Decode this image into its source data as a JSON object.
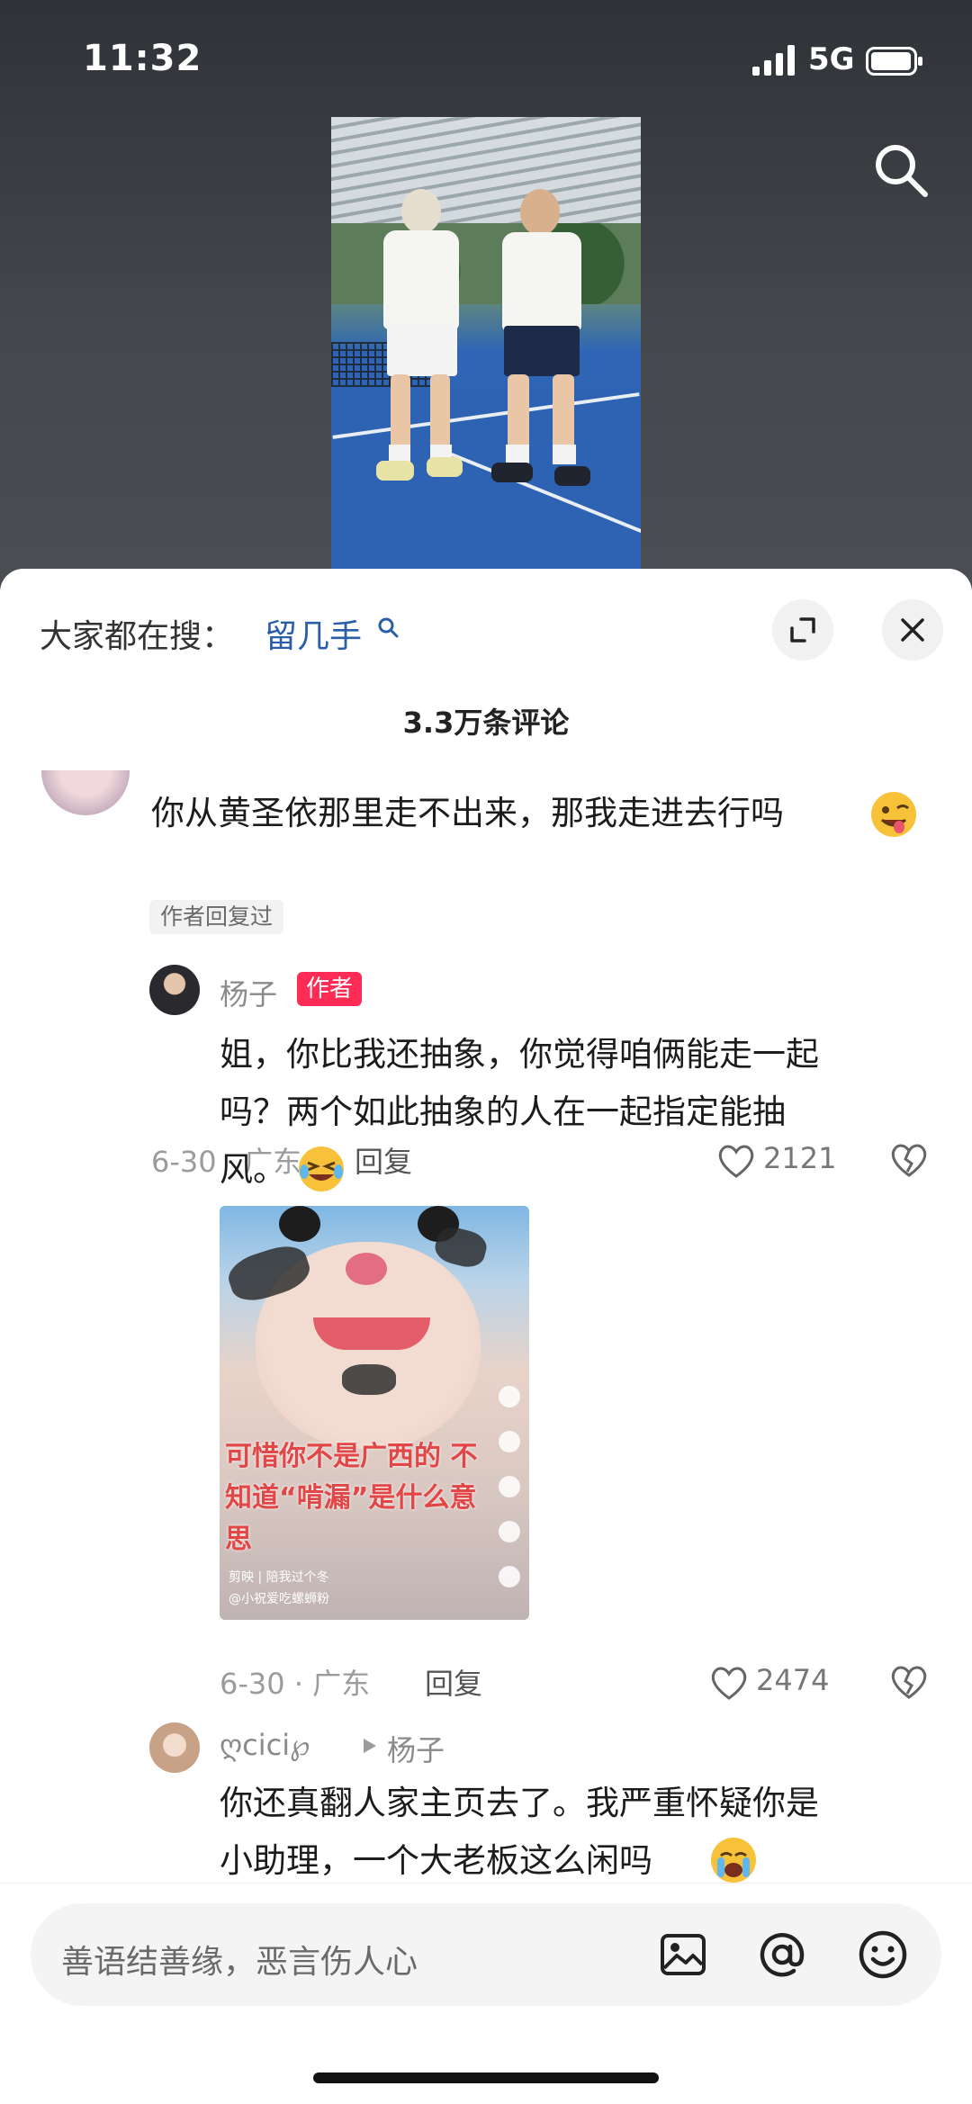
{
  "status": {
    "time": "11:32",
    "network": "5G"
  },
  "icons": {
    "search": "search-icon",
    "expand": "expand-icon",
    "close": "close-icon",
    "like": "heart-icon",
    "dislike": "broken-heart-icon",
    "image": "image-icon",
    "mention": "at-icon",
    "emoji": "smiley-icon"
  },
  "hot_search": {
    "label": "大家都在搜：",
    "term": "留几手"
  },
  "comments_header": {
    "count_text": "3.3万条评论"
  },
  "comments": [
    {
      "text_line1": "你从黄圣依那里走不出来，那我走进去行吗",
      "meta": "6-30 · 广东",
      "reply_label": "回复",
      "likes": "2121",
      "author_replied": "作者回复过"
    }
  ],
  "replies": [
    {
      "username": "杨子",
      "badge": "作者",
      "text_line1": "姐，你比我还抽象，你觉得咱俩能走一起",
      "text_line2": "吗？两个如此抽象的人在一起指定能抽",
      "text_line3": "风。",
      "image_caption": "可惜你不是广西的 不知道“啃漏”是什么意思",
      "image_footer1": "剪映 | 陪我过个冬",
      "image_footer2": "@小祝爱吃螺蛳粉",
      "meta": "6-30 · 广东",
      "reply_label": "回复",
      "likes": "2474"
    },
    {
      "username": "ღcici℘",
      "reply_to": "杨子",
      "text_line1": "你还真翻人家主页去了。我严重怀疑你是",
      "text_line2": "小助理，一个大老板这么闲吗"
    }
  ],
  "input": {
    "placeholder": "善语结善缘，恶言伤人心"
  },
  "colors": {
    "accent_red": "#fe2c55",
    "hot_term_blue": "#2a5ea8"
  }
}
